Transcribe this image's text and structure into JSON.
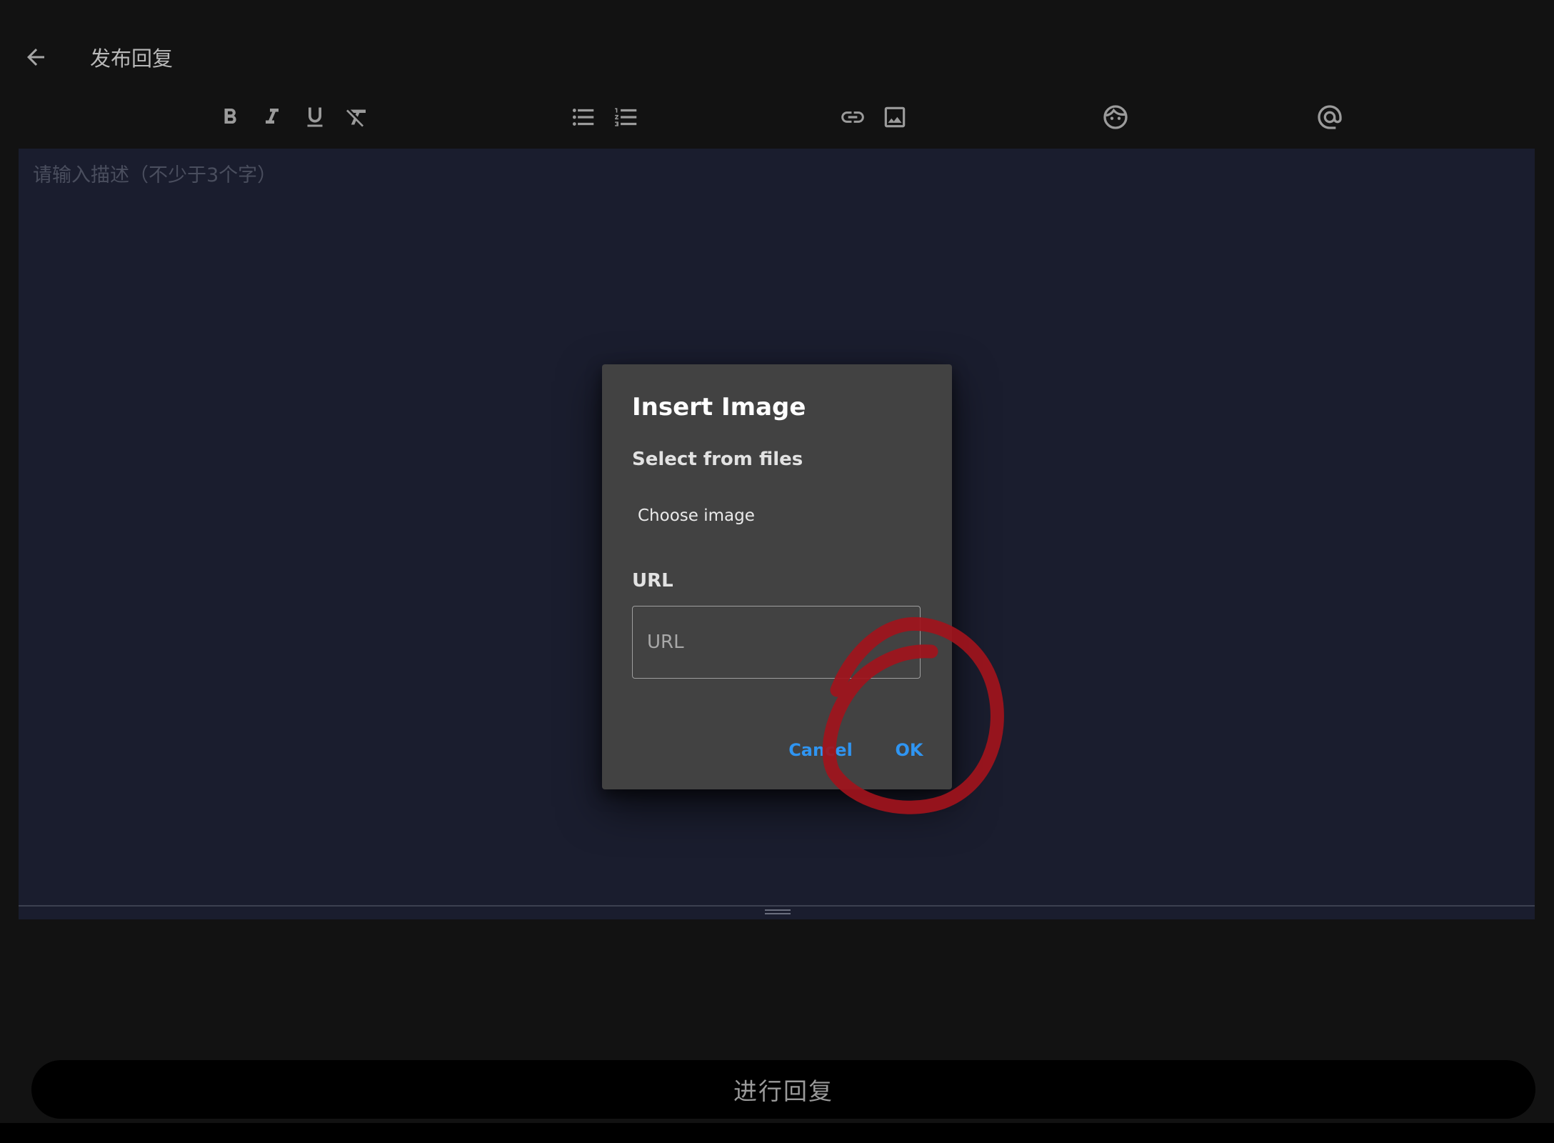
{
  "header": {
    "back_icon": "arrow-left-icon",
    "title": "发布回复"
  },
  "toolbar": {
    "tools": [
      "bold",
      "italic",
      "underline",
      "clear-format",
      "bulleted-list",
      "numbered-list",
      "link",
      "image",
      "emoji",
      "mention"
    ]
  },
  "editor": {
    "placeholder": "请输入描述（不少于3个字）"
  },
  "dialog": {
    "title": "Insert Image",
    "files_heading": "Select from files",
    "choose_label": "Choose image",
    "url_heading": "URL",
    "url_placeholder": "URL",
    "url_value": "",
    "cancel_label": "Cancel",
    "ok_label": "OK"
  },
  "submit": {
    "label": "进行回复"
  },
  "colors": {
    "background": "#121212",
    "editor_bg": "#1a1d2e",
    "dialog_bg": "#424242",
    "accent": "#2f95f2",
    "annotation": "#a1141c"
  }
}
